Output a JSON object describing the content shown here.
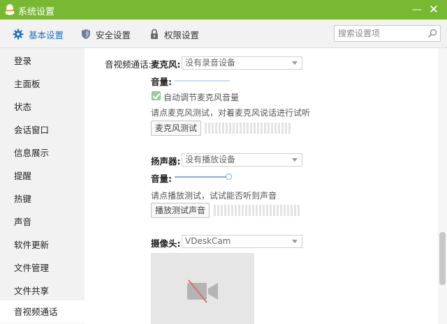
{
  "window": {
    "title": "系统设置",
    "accent": "#78b832",
    "minimize_icon": "minimize-icon",
    "close_icon": "close-icon"
  },
  "toolbar": {
    "tabs": [
      {
        "label": "基本设置",
        "icon": "gear-icon",
        "active": true,
        "color": "#1b72c4"
      },
      {
        "label": "安全设置",
        "icon": "shield-icon",
        "active": false
      },
      {
        "label": "权限设置",
        "icon": "lock-icon",
        "active": false
      }
    ],
    "search": {
      "placeholder": "搜索设置项",
      "value": ""
    }
  },
  "sidebar": {
    "items": [
      {
        "label": "登录"
      },
      {
        "label": "主面板"
      },
      {
        "label": "状态"
      },
      {
        "label": "会话窗口"
      },
      {
        "label": "信息展示"
      },
      {
        "label": "提醒"
      },
      {
        "label": "热键"
      },
      {
        "label": "声音"
      },
      {
        "label": "软件更新"
      },
      {
        "label": "文件管理"
      },
      {
        "label": "文件共享"
      },
      {
        "label": "音视频通话",
        "active": true
      }
    ]
  },
  "av": {
    "section_label": "音视频通话:",
    "mic": {
      "label": "麦克风:",
      "device": "没有录音设备",
      "volume_label": "音量:",
      "volume_level": 0,
      "auto_adjust_label": "自动调节麦克风音量",
      "auto_adjust_checked": true,
      "test_hint": "请点麦克风测试，对着麦克风说话进行试听",
      "test_button": "麦克风测试"
    },
    "speaker": {
      "label": "扬声器:",
      "device": "没有播放设备",
      "volume_label": "音量:",
      "volume_level": 1.0,
      "test_hint": "请点播放测试，试试能否听到声音",
      "test_button": "播放测试声音"
    },
    "camera": {
      "label": "摄像头:",
      "device": "VDeskCam",
      "preview_icon": "camera-off-icon"
    }
  }
}
